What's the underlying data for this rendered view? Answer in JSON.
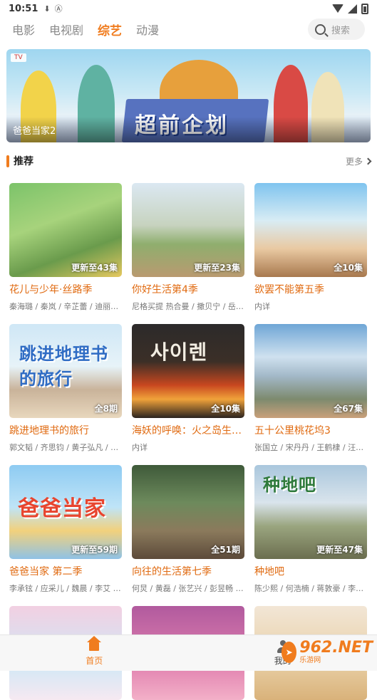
{
  "status": {
    "time": "10:51",
    "icons": [
      "download-icon",
      "a-icon"
    ]
  },
  "tabs": [
    {
      "label": "电影"
    },
    {
      "label": "电视剧"
    },
    {
      "label": "综艺",
      "active": true
    },
    {
      "label": "动漫"
    }
  ],
  "search": {
    "placeholder": "搜索"
  },
  "banner": {
    "caption": "爸爸当家2",
    "art_title": "超前企划"
  },
  "section": {
    "title": "推荐",
    "more": "更多"
  },
  "cards": [
    {
      "title": "花儿与少年·丝路季",
      "cast": "秦海璐 / 秦岚 / 辛芷蕾 / 迪丽…",
      "badge": "更新至43集",
      "bg": "linear-gradient(160deg,#7cc36a 0%,#a7d37c 40%,#6a9b4c 70%,#e6c85f 100%)"
    },
    {
      "title": "你好生活第4季",
      "cast": "尼格买提 热合曼 / 撒贝宁 / 岳…",
      "badge": "更新至23集",
      "bg": "linear-gradient(180deg,#dbe8f2 0%,#c7d3bf 45%,#8fae6e 65%,#b99a70 100%)"
    },
    {
      "title": "欲罢不能第五季",
      "cast": "内详",
      "badge": "全10集",
      "bg": "linear-gradient(180deg,#7fc4ef 0%,#d8ecf4 40%,#e9c9a2 70%,#a8794e 100%)"
    },
    {
      "title": "跳进地理书的旅行",
      "cast": "郭文韬 / 齐思钧 / 黄子弘凡 / …",
      "badge": "全8期",
      "bg": "linear-gradient(180deg,#cfe7f6 0%,#e7f3f8 45%,#c9b39a 70%,#e8d7bd 100%)",
      "art": "跳进地理书的旅行"
    },
    {
      "title": "海妖的呼唤：火之岛生…",
      "cast": "内详",
      "badge": "全10集",
      "bg": "linear-gradient(180deg,#2c2a2a 0%,#3b2f27 40%,#c8471f 65%,#f0a23a 80%,#2a2320 100%)",
      "art": "사이렌"
    },
    {
      "title": "五十公里桃花坞3",
      "cast": "张国立 / 宋丹丹 / 王鹤棣 / 汪苏…",
      "badge": "全67集",
      "bg": "linear-gradient(180deg,#6fa6d6 0%,#cfe1ef 35%,#a3b9c9 55%,#7d8a6e 80%,#c9a07a 100%)"
    },
    {
      "title": "爸爸当家 第二季",
      "cast": "李承铉 / 应采儿 / 魏晨 / 李艾 / …",
      "badge": "更新至59期",
      "bg": "linear-gradient(180deg,#8ecbf2 0%,#bfe4f7 45%,#f2d17c 70%,#8fc2e6 100%)",
      "art": "爸爸当家"
    },
    {
      "title": "向往的生活第七季",
      "cast": "何炅 / 黄磊 / 张艺兴 / 彭昱畅 / …",
      "badge": "全51期",
      "bg": "linear-gradient(180deg,#3f5a3a 0%,#6d8a5c 40%,#8b7a5c 70%,#5c4a3a 100%)"
    },
    {
      "title": "种地吧",
      "cast": "陈少熙 / 何浩楠 / 蒋敦豪 / 李耕…",
      "badge": "更新至47集",
      "bg": "linear-gradient(180deg,#aac7dd 0%,#d9e4ec 40%,#9aa57f 65%,#6b6e4f 100%)",
      "art": "种地吧"
    },
    {
      "title": "",
      "cast": "",
      "badge": "",
      "bg": "linear-gradient(180deg,#f2d0e2 0%,#cfe7f6 60%,#f6e9f1 100%)"
    },
    {
      "title": "",
      "cast": "",
      "badge": "",
      "bg": "linear-gradient(180deg,#b15a9e 0%,#e07fae 60%,#f3b0c8 100%)"
    },
    {
      "title": "",
      "cast": "",
      "badge": "",
      "bg": "linear-gradient(180deg,#f2e6d6 0%,#e8cfa5 60%,#d9b27a 100%)"
    }
  ],
  "bottom_nav": [
    {
      "label": "首页",
      "active": true
    },
    {
      "label": "我的"
    }
  ],
  "watermark": {
    "big": "962.NET",
    "small": "乐游网"
  },
  "colors": {
    "accent": "#f07c1e",
    "title": "#e06a10"
  }
}
